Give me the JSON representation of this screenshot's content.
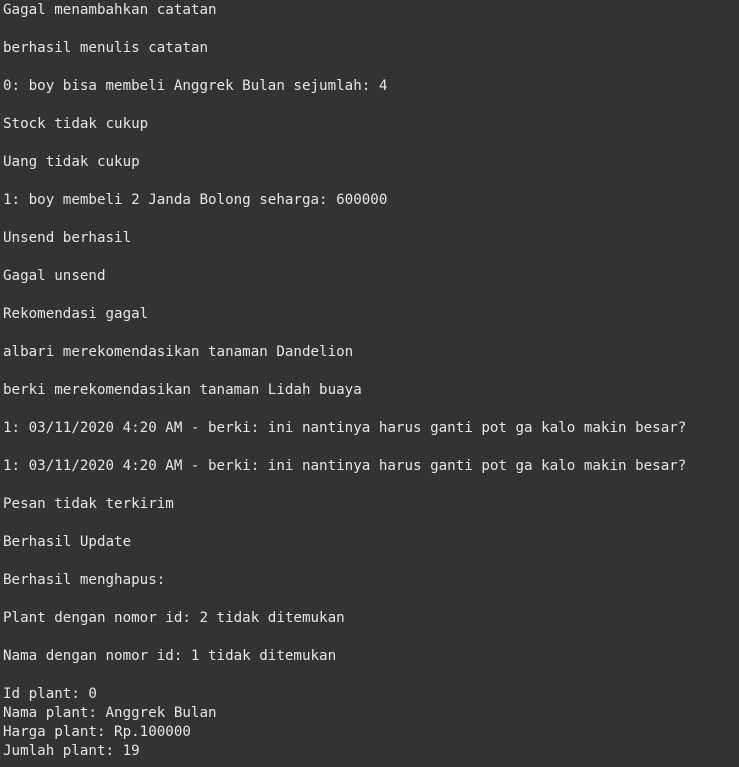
{
  "console": {
    "lines": [
      "Gagal menambahkan catatan",
      "berhasil menulis catatan",
      "0: boy bisa membeli Anggrek Bulan sejumlah: 4",
      "Stock tidak cukup",
      "Uang tidak cukup",
      "1: boy membeli 2 Janda Bolong seharga: 600000",
      "Unsend berhasil",
      "Gagal unsend",
      "Rekomendasi gagal",
      "albari merekomendasikan tanaman Dandelion",
      "berki merekomendasikan tanaman Lidah buaya",
      "1: 03/11/2020 4:20 AM - berki: ini nantinya harus ganti pot ga kalo makin besar?",
      "1: 03/11/2020 4:20 AM - berki: ini nantinya harus ganti pot ga kalo makin besar?",
      "Pesan tidak terkirim",
      "Berhasil Update",
      "Berhasil menghapus:",
      "Plant dengan nomor id: 2 tidak ditemukan",
      "Nama dengan nomor id: 1 tidak ditemukan",
      "Id plant: 0",
      "Nama plant: Anggrek Bulan",
      "Harga plant: Rp.100000",
      "Jumlah plant: 19"
    ]
  }
}
